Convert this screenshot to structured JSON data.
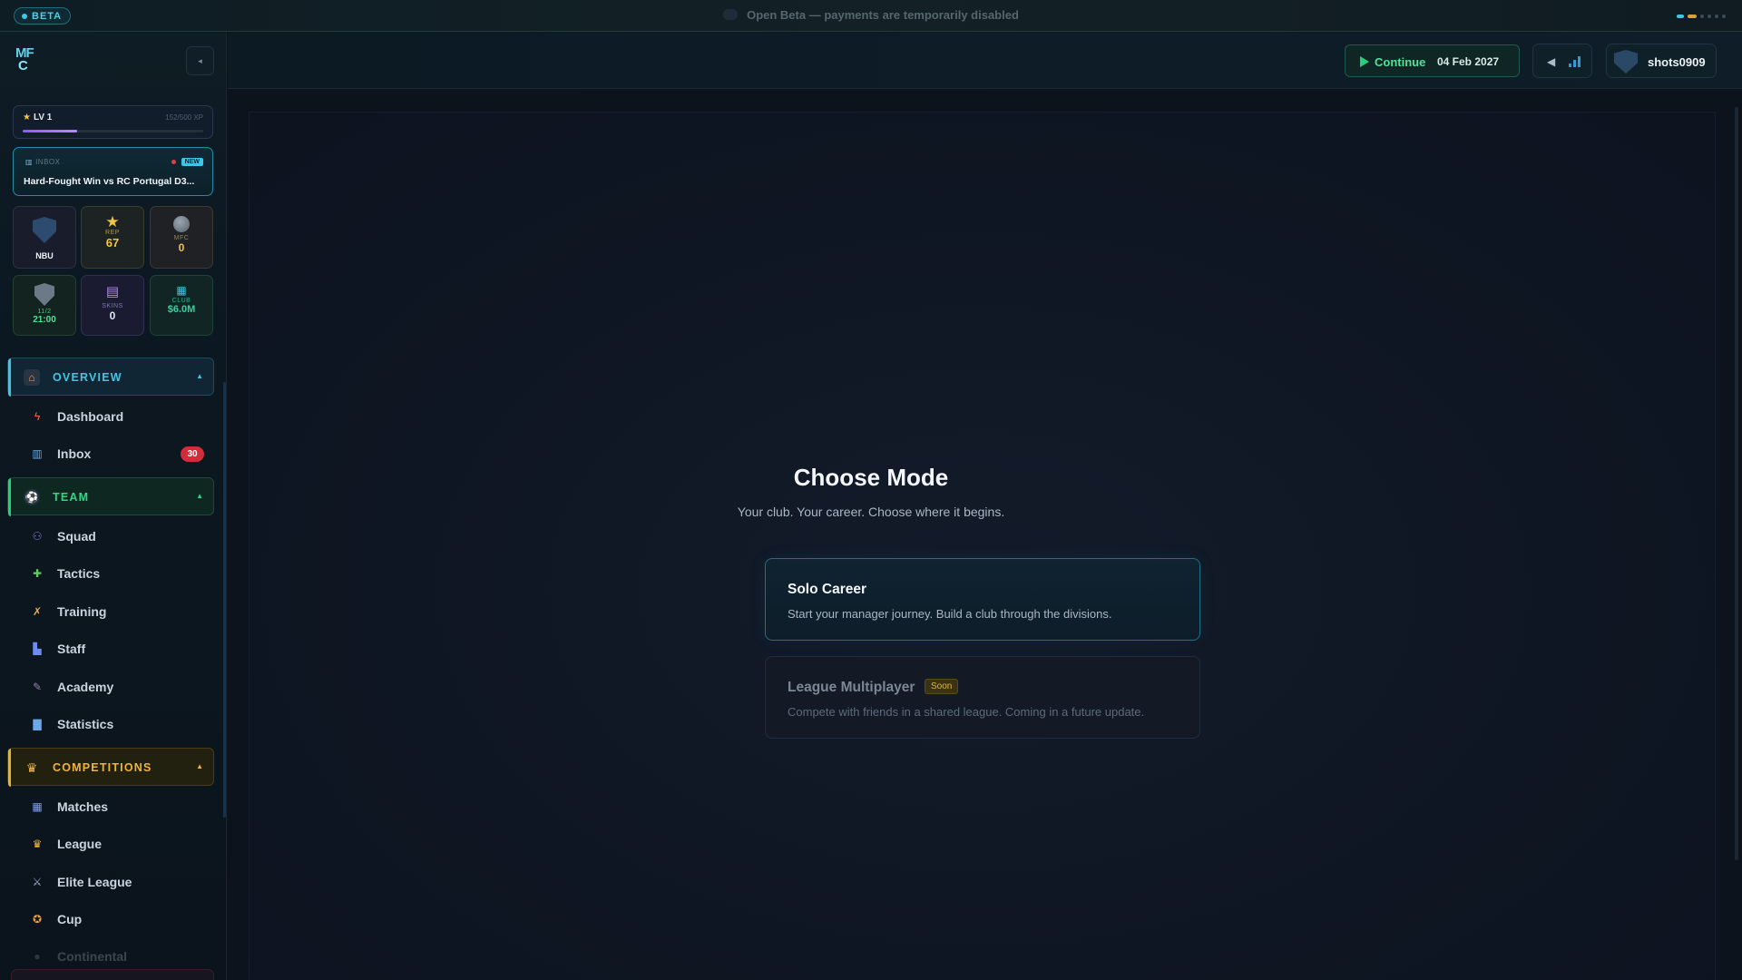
{
  "banner": {
    "badge": "BETA",
    "message": "Open Beta — payments are temporarily disabled"
  },
  "sidebar": {
    "logo": {
      "line1": "MF",
      "line2": "C"
    },
    "collapse_icon": "chevron-left-icon",
    "level": {
      "label": "LV 1",
      "xp": "152/500 XP",
      "progress": 0.304
    },
    "inbox_card": {
      "tag": "INBOX",
      "badge": "NEW",
      "title": "Hard-Fought Win vs RC Portugal D3..."
    },
    "tiles": [
      {
        "id": "club",
        "label": "",
        "value": "NBU"
      },
      {
        "id": "rep",
        "label": "REP",
        "value": "67"
      },
      {
        "id": "mfc",
        "label": "MFC",
        "value": "0"
      },
      {
        "id": "next",
        "label": "11/2",
        "value": "21:00"
      },
      {
        "id": "skins",
        "label": "SKINS",
        "value": "0"
      },
      {
        "id": "club-funds",
        "label": "CLUB",
        "value": "$6.0M"
      }
    ],
    "sections": {
      "overview": {
        "label": "OVERVIEW"
      },
      "team": {
        "label": "TEAM"
      },
      "competitions": {
        "label": "COMPETITIONS"
      }
    },
    "items": {
      "dashboard": "Dashboard",
      "inbox": "Inbox",
      "inbox_count": "30",
      "squad": "Squad",
      "tactics": "Tactics",
      "training": "Training",
      "staff": "Staff",
      "academy": "Academy",
      "statistics": "Statistics",
      "matches": "Matches",
      "league": "League",
      "elite_league": "Elite League",
      "cup": "Cup",
      "continental": "Continental"
    }
  },
  "header": {
    "continue_label": "Continue",
    "date": "04 Feb 2027",
    "username": "shots0909"
  },
  "main": {
    "title": "Choose Mode",
    "subtitle": "Your club. Your career. Choose where it begins.",
    "modes": [
      {
        "title": "Solo Career",
        "description": "Start your manager journey. Build a club through the divisions."
      },
      {
        "title": "League Multiplayer",
        "badge": "Soon",
        "description": "Compete with friends in a shared league. Coming in a future update."
      }
    ]
  },
  "colors": {
    "accent_cyan": "#3ec7e4",
    "accent_green": "#24d07a",
    "accent_gold": "#e2b634",
    "badge_red": "#d42b3a"
  }
}
